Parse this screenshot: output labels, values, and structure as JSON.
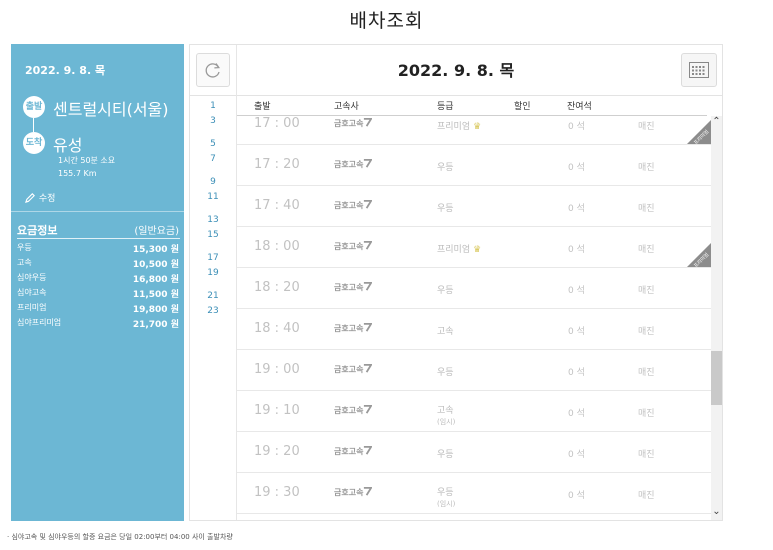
{
  "page_title": "배차조회",
  "info": {
    "date": "2022. 9. 8. 목",
    "departure_badge": "출발",
    "departure": "센트럴시티(서울)",
    "arrival_badge": "도착",
    "arrival": "유성",
    "duration": "1시간 50분 소요",
    "distance": "155.7 Km",
    "edit_label": "수정",
    "fare_title": "요금정보",
    "fare_type": "(일반요금)",
    "fares": [
      {
        "grade": "우등",
        "price": "15,300 원"
      },
      {
        "grade": "고속",
        "price": "10,500 원"
      },
      {
        "grade": "심야우등",
        "price": "16,800 원"
      },
      {
        "grade": "심야고속",
        "price": "11,500 원"
      },
      {
        "grade": "프리미엄",
        "price": "19,800 원"
      },
      {
        "grade": "심야프리미엄",
        "price": "21,700 원"
      }
    ]
  },
  "schedule": {
    "date": "2022. 9. 8. 목",
    "hours": [
      "1",
      "3",
      "5",
      "7",
      "9",
      "11",
      "13",
      "15",
      "17",
      "19",
      "21",
      "23"
    ],
    "headers": {
      "departure": "출발",
      "company": "고속사",
      "grade": "등급",
      "discount": "할인",
      "seats": "잔여석"
    },
    "premium_tag": "프리미엄",
    "rows": [
      {
        "time": "17 : 00",
        "company": "금호고속",
        "grade": "프리미엄",
        "crown": true,
        "sub": "",
        "seats": "0 석",
        "status": "매진",
        "tag": true
      },
      {
        "time": "17 : 20",
        "company": "금호고속",
        "grade": "우등",
        "crown": false,
        "sub": "",
        "seats": "0 석",
        "status": "매진",
        "tag": false
      },
      {
        "time": "17 : 40",
        "company": "금호고속",
        "grade": "우등",
        "crown": false,
        "sub": "",
        "seats": "0 석",
        "status": "매진",
        "tag": false
      },
      {
        "time": "18 : 00",
        "company": "금호고속",
        "grade": "프리미엄",
        "crown": true,
        "sub": "",
        "seats": "0 석",
        "status": "매진",
        "tag": true
      },
      {
        "time": "18 : 20",
        "company": "금호고속",
        "grade": "우등",
        "crown": false,
        "sub": "",
        "seats": "0 석",
        "status": "매진",
        "tag": false
      },
      {
        "time": "18 : 40",
        "company": "금호고속",
        "grade": "고속",
        "crown": false,
        "sub": "",
        "seats": "0 석",
        "status": "매진",
        "tag": false
      },
      {
        "time": "19 : 00",
        "company": "금호고속",
        "grade": "우등",
        "crown": false,
        "sub": "",
        "seats": "0 석",
        "status": "매진",
        "tag": false
      },
      {
        "time": "19 : 10",
        "company": "금호고속",
        "grade": "고속",
        "crown": false,
        "sub": "(임시)",
        "seats": "0 석",
        "status": "매진",
        "tag": false
      },
      {
        "time": "19 : 20",
        "company": "금호고속",
        "grade": "우등",
        "crown": false,
        "sub": "",
        "seats": "0 석",
        "status": "매진",
        "tag": false
      },
      {
        "time": "19 : 30",
        "company": "금호고속",
        "grade": "우등",
        "crown": false,
        "sub": "(임시)",
        "seats": "0 석",
        "status": "매진",
        "tag": false
      }
    ]
  },
  "footnote": "· 심야고속 및 심야우등의 할증 요금은 당일 02:00부터 04:00 사이 출발차량",
  "colors": {
    "panel": "#6cb7d4",
    "hour_link": "#3c8fb7",
    "company_logo": "#999999"
  }
}
